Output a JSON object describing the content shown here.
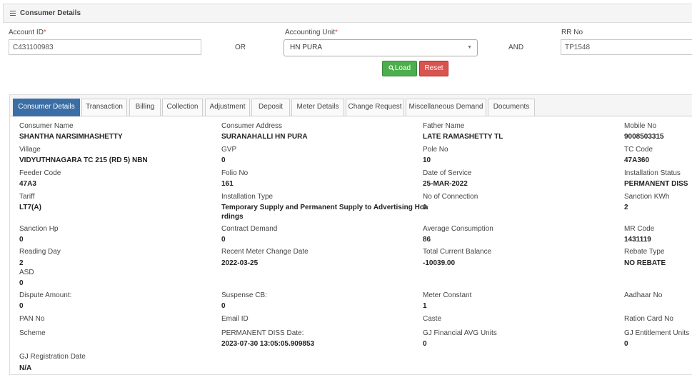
{
  "panel": {
    "title": "Consumer Details"
  },
  "search": {
    "account_id_label": "Account ID",
    "account_id_value": "C431100983",
    "or_text": "OR",
    "accounting_unit_label": "Accounting Unit",
    "accounting_unit_value": "HN PURA",
    "and_text": "AND",
    "rr_label": "RR No",
    "rr_value": "TP1548",
    "required_mark": "*"
  },
  "buttons": {
    "load": "Load",
    "reset": "Reset"
  },
  "tabs": [
    "Consumer Details",
    "Transaction",
    "Billing",
    "Collection",
    "Adjustment",
    "Deposit",
    "Meter Details",
    "Change Request",
    "Miscellaneous Demand",
    "Documents"
  ],
  "active_tab": 0,
  "fields": [
    {
      "label": "Consumer Name",
      "value": "SHANTHA NARSIMHASHETTY"
    },
    {
      "label": "Consumer Address",
      "value": "SURANAHALLI HN PURA"
    },
    {
      "label": "Father Name",
      "value": "LATE RAMASHETTY TL"
    },
    {
      "label": "Mobile No",
      "value": "9008503315"
    },
    {
      "label": "Village",
      "value": "VIDYUTHNAGARA TC 215 (RD 5) NBN"
    },
    {
      "label": "GVP",
      "value": "0"
    },
    {
      "label": "Pole No",
      "value": "10"
    },
    {
      "label": "TC Code",
      "value": "47A360"
    },
    {
      "label": "Feeder Code",
      "value": "47A3"
    },
    {
      "label": "Folio No",
      "value": "161"
    },
    {
      "label": "Date of Service",
      "value": "25-MAR-2022"
    },
    {
      "label": "Installation Status",
      "value": "PERMANENT DISS"
    },
    {
      "label": "Tariff",
      "value": "LT7(A)"
    },
    {
      "label": "Installation Type",
      "value": "Temporary Supply and Permanent Supply to Advertising Hoa",
      "value2": "rdings"
    },
    {
      "label": "No of Connection",
      "value": "1"
    },
    {
      "label": "Sanction KWh",
      "value": "2"
    },
    {
      "label": "Sanction Hp",
      "value": "0"
    },
    {
      "label": "Contract Demand",
      "value": "0"
    },
    {
      "label": "Average Consumption",
      "value": "86"
    },
    {
      "label": "MR Code",
      "value": "1431119"
    },
    {
      "label": "Reading Day",
      "value": "2"
    },
    {
      "label": "Recent Meter Change Date",
      "value": "2022-03-25"
    },
    {
      "label": "Total Current Balance",
      "value": "-10039.00"
    },
    {
      "label": "Rebate Type",
      "value": "NO REBATE"
    },
    {
      "label": "ASD",
      "value": "0"
    },
    {
      "label": "Dispute Amount:",
      "value": "0"
    },
    {
      "label": "Suspense CB:",
      "value": "0"
    },
    {
      "label": "Meter Constant",
      "value": "1"
    },
    {
      "label": "Aadhaar No",
      "value": ""
    },
    {
      "label": "PAN No",
      "value": ""
    },
    {
      "label": "Email ID",
      "value": ""
    },
    {
      "label": "Caste",
      "value": ""
    },
    {
      "label": "Ration Card No",
      "value": ""
    },
    {
      "label": "Scheme",
      "value": ""
    },
    {
      "label": "PERMANENT DISS Date:",
      "value": "2023-07-30 13:05:05.909853"
    },
    {
      "label": "GJ Financial AVG Units",
      "value": "0"
    },
    {
      "label": "GJ Entitlement Units",
      "value": "0"
    },
    {
      "label": "GJ Registration Date",
      "value": "N/A"
    }
  ]
}
